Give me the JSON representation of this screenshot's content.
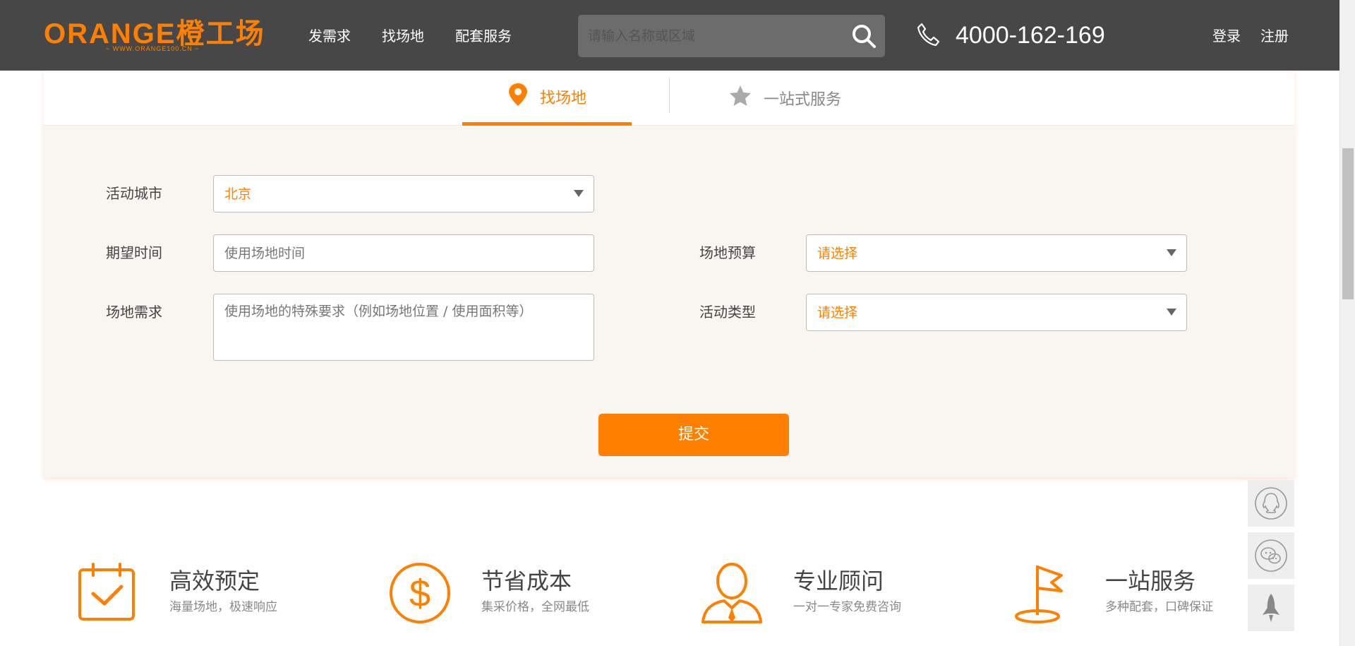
{
  "brand": {
    "name": "ORANGE橙工场",
    "subtitle": "~ WWW.ORANGE100.CN ~",
    "color": "#ff8000"
  },
  "nav": [
    {
      "label": "发需求"
    },
    {
      "label": "找场地"
    },
    {
      "label": "配套服务"
    }
  ],
  "search": {
    "placeholder": "请输入名称或区域",
    "value": ""
  },
  "contact": {
    "phone": "4000-162-169"
  },
  "auth": {
    "login": "登录",
    "register": "注册"
  },
  "tabs": [
    {
      "label": "找场地",
      "active": true,
      "icon": "map-pin-icon"
    },
    {
      "label": "一站式服务",
      "active": false,
      "icon": "star-icon"
    }
  ],
  "form": {
    "city": {
      "label": "活动城市",
      "value": "北京"
    },
    "time": {
      "label": "期望时间",
      "placeholder": "使用场地时间"
    },
    "budget": {
      "label": "场地预算",
      "value": "请选择"
    },
    "requirement": {
      "label": "场地需求",
      "placeholder": "使用场地的特殊要求（例如场地位置 / 使用面积等）"
    },
    "type": {
      "label": "活动类型",
      "value": "请选择"
    },
    "submit": "提交"
  },
  "features": [
    {
      "title": "高效预定",
      "subtitle": "海量场地，极速响应",
      "icon": "calendar-check-icon"
    },
    {
      "title": "节省成本",
      "subtitle": "集采价格，全网最低",
      "icon": "dollar-icon"
    },
    {
      "title": "专业顾问",
      "subtitle": "一对一专家免费咨询",
      "icon": "consultant-icon"
    },
    {
      "title": "一站服务",
      "subtitle": "多种配套，口碑保证",
      "icon": "flag-icon"
    }
  ],
  "side": [
    {
      "icon": "qq-icon"
    },
    {
      "icon": "wechat-icon"
    },
    {
      "icon": "rocket-icon"
    }
  ]
}
